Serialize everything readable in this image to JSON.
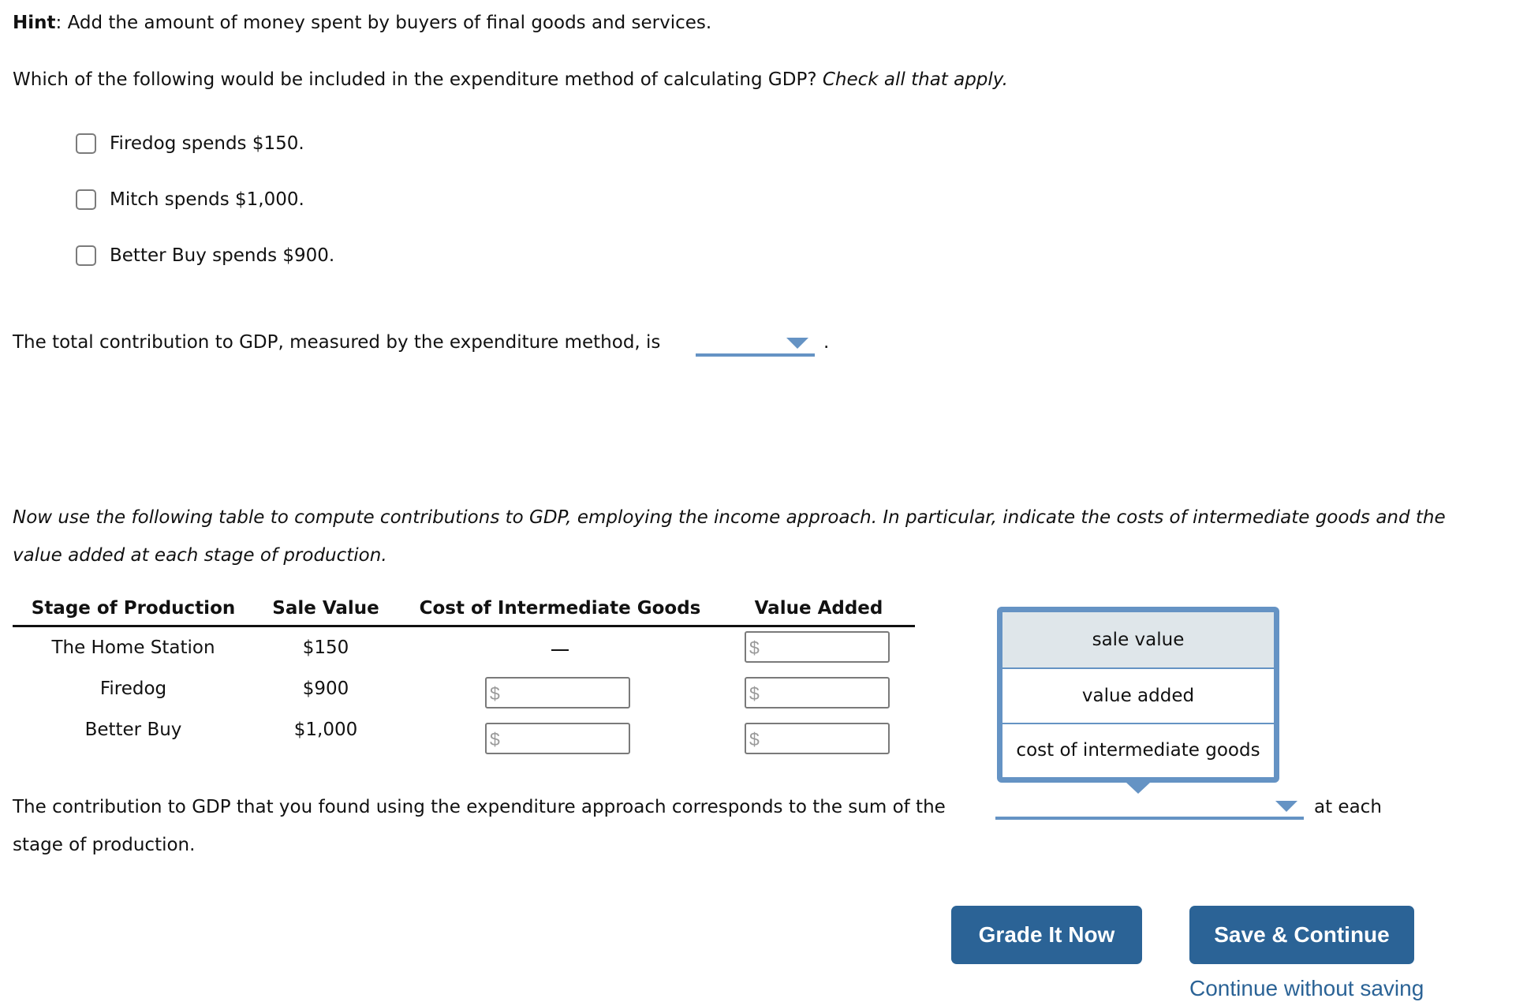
{
  "hint": {
    "label": "Hint",
    "text": ": Add the amount of money spent by buyers of final goods and services."
  },
  "question": {
    "text": "Which of the following would be included in the expenditure method of calculating GDP? ",
    "instruction": "Check all that apply."
  },
  "options": [
    {
      "label": "Firedog spends $150.",
      "checked": false
    },
    {
      "label": "Mitch spends $1,000.",
      "checked": false
    },
    {
      "label": "Better Buy spends $900.",
      "checked": false
    }
  ],
  "total": {
    "text": "The total contribution to GDP, measured by the expenditure method, is",
    "selected": "",
    "suffix": "."
  },
  "instructions": "Now use the following table to compute contributions to GDP, employing the income approach. In particular, indicate the costs of intermediate goods and the value added at each stage of production.",
  "table": {
    "headers": [
      "Stage of Production",
      "Sale Value",
      "Cost of Intermediate Goods",
      "Value Added"
    ],
    "rows": [
      {
        "stage": "The Home Station",
        "sale_value": "$150",
        "cost": "—",
        "value_added": ""
      },
      {
        "stage": "Firedog",
        "sale_value": "$900",
        "cost": "",
        "value_added": ""
      },
      {
        "stage": "Better Buy",
        "sale_value": "$1,000",
        "cost": "",
        "value_added": ""
      }
    ],
    "currency_prefix": "$"
  },
  "dropdown_popup": {
    "items": [
      {
        "label": "sale value",
        "highlighted": true
      },
      {
        "label": "value added",
        "highlighted": false
      },
      {
        "label": "cost of intermediate goods",
        "highlighted": false
      }
    ]
  },
  "contribution": {
    "text": "The contribution to GDP that you found using the expenditure approach corresponds to the sum of the",
    "selected": "",
    "suffix": "at each",
    "line2": "stage of production."
  },
  "buttons": {
    "grade": "Grade It Now",
    "save": "Save & Continue",
    "continue_link": "Continue without saving"
  },
  "colors": {
    "accent": "#6593c4",
    "button": "#2b6396",
    "highlight": "#dfe6ea"
  }
}
